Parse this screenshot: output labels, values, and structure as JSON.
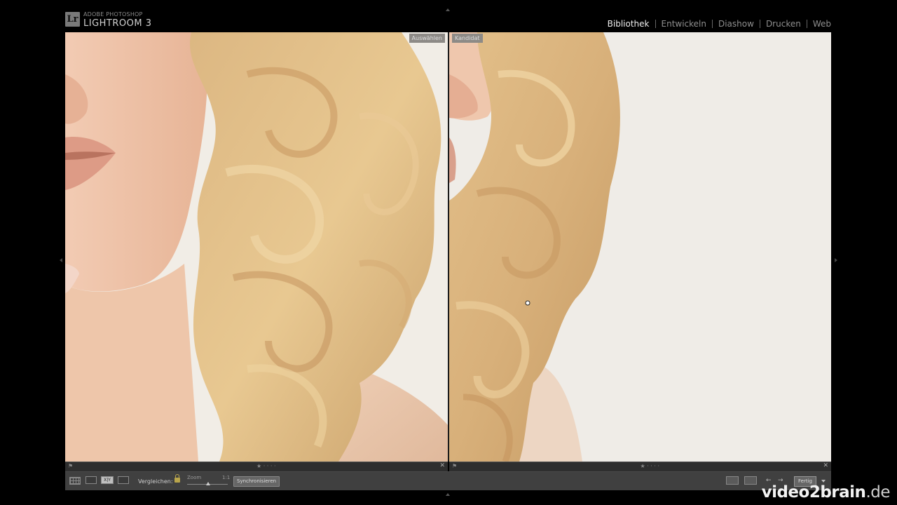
{
  "app": {
    "brand_small": "ADOBE PHOTOSHOP",
    "brand_name": "LIGHTROOM 3",
    "badge": "Lr"
  },
  "modules": [
    {
      "label": "Bibliothek",
      "active": true
    },
    {
      "label": "Entwickeln",
      "active": false
    },
    {
      "label": "Diashow",
      "active": false
    },
    {
      "label": "Drucken",
      "active": false
    },
    {
      "label": "Web",
      "active": false
    }
  ],
  "compare": {
    "left_label": "Auswählen",
    "right_label": "Kandidat"
  },
  "toolbar": {
    "compare_label": "Vergleichen:",
    "zoom_label": "Zoom",
    "zoom_value": "1:1",
    "sync_label": "Synchronisieren",
    "done_label": "Fertig",
    "xy_label": "X|Y"
  },
  "watermark": {
    "brand": "video2brain",
    "tld": ".de"
  },
  "colors": {
    "background": "#000000",
    "accent_lock": "#b9a54b",
    "toolbar": "#404040"
  }
}
